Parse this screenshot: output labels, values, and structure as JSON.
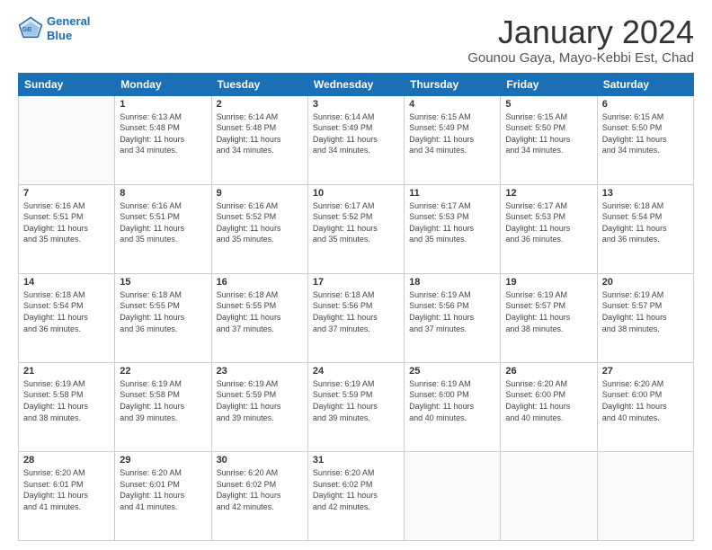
{
  "header": {
    "logo": {
      "line1": "General",
      "line2": "Blue"
    },
    "title": "January 2024",
    "subtitle": "Gounou Gaya, Mayo-Kebbi Est, Chad"
  },
  "days_of_week": [
    "Sunday",
    "Monday",
    "Tuesday",
    "Wednesday",
    "Thursday",
    "Friday",
    "Saturday"
  ],
  "weeks": [
    [
      {
        "num": "",
        "info": ""
      },
      {
        "num": "1",
        "info": "Sunrise: 6:13 AM\nSunset: 5:48 PM\nDaylight: 11 hours\nand 34 minutes."
      },
      {
        "num": "2",
        "info": "Sunrise: 6:14 AM\nSunset: 5:48 PM\nDaylight: 11 hours\nand 34 minutes."
      },
      {
        "num": "3",
        "info": "Sunrise: 6:14 AM\nSunset: 5:49 PM\nDaylight: 11 hours\nand 34 minutes."
      },
      {
        "num": "4",
        "info": "Sunrise: 6:15 AM\nSunset: 5:49 PM\nDaylight: 11 hours\nand 34 minutes."
      },
      {
        "num": "5",
        "info": "Sunrise: 6:15 AM\nSunset: 5:50 PM\nDaylight: 11 hours\nand 34 minutes."
      },
      {
        "num": "6",
        "info": "Sunrise: 6:15 AM\nSunset: 5:50 PM\nDaylight: 11 hours\nand 34 minutes."
      }
    ],
    [
      {
        "num": "7",
        "info": "Sunrise: 6:16 AM\nSunset: 5:51 PM\nDaylight: 11 hours\nand 35 minutes."
      },
      {
        "num": "8",
        "info": "Sunrise: 6:16 AM\nSunset: 5:51 PM\nDaylight: 11 hours\nand 35 minutes."
      },
      {
        "num": "9",
        "info": "Sunrise: 6:16 AM\nSunset: 5:52 PM\nDaylight: 11 hours\nand 35 minutes."
      },
      {
        "num": "10",
        "info": "Sunrise: 6:17 AM\nSunset: 5:52 PM\nDaylight: 11 hours\nand 35 minutes."
      },
      {
        "num": "11",
        "info": "Sunrise: 6:17 AM\nSunset: 5:53 PM\nDaylight: 11 hours\nand 35 minutes."
      },
      {
        "num": "12",
        "info": "Sunrise: 6:17 AM\nSunset: 5:53 PM\nDaylight: 11 hours\nand 36 minutes."
      },
      {
        "num": "13",
        "info": "Sunrise: 6:18 AM\nSunset: 5:54 PM\nDaylight: 11 hours\nand 36 minutes."
      }
    ],
    [
      {
        "num": "14",
        "info": "Sunrise: 6:18 AM\nSunset: 5:54 PM\nDaylight: 11 hours\nand 36 minutes."
      },
      {
        "num": "15",
        "info": "Sunrise: 6:18 AM\nSunset: 5:55 PM\nDaylight: 11 hours\nand 36 minutes."
      },
      {
        "num": "16",
        "info": "Sunrise: 6:18 AM\nSunset: 5:55 PM\nDaylight: 11 hours\nand 37 minutes."
      },
      {
        "num": "17",
        "info": "Sunrise: 6:18 AM\nSunset: 5:56 PM\nDaylight: 11 hours\nand 37 minutes."
      },
      {
        "num": "18",
        "info": "Sunrise: 6:19 AM\nSunset: 5:56 PM\nDaylight: 11 hours\nand 37 minutes."
      },
      {
        "num": "19",
        "info": "Sunrise: 6:19 AM\nSunset: 5:57 PM\nDaylight: 11 hours\nand 38 minutes."
      },
      {
        "num": "20",
        "info": "Sunrise: 6:19 AM\nSunset: 5:57 PM\nDaylight: 11 hours\nand 38 minutes."
      }
    ],
    [
      {
        "num": "21",
        "info": "Sunrise: 6:19 AM\nSunset: 5:58 PM\nDaylight: 11 hours\nand 38 minutes."
      },
      {
        "num": "22",
        "info": "Sunrise: 6:19 AM\nSunset: 5:58 PM\nDaylight: 11 hours\nand 39 minutes."
      },
      {
        "num": "23",
        "info": "Sunrise: 6:19 AM\nSunset: 5:59 PM\nDaylight: 11 hours\nand 39 minutes."
      },
      {
        "num": "24",
        "info": "Sunrise: 6:19 AM\nSunset: 5:59 PM\nDaylight: 11 hours\nand 39 minutes."
      },
      {
        "num": "25",
        "info": "Sunrise: 6:19 AM\nSunset: 6:00 PM\nDaylight: 11 hours\nand 40 minutes."
      },
      {
        "num": "26",
        "info": "Sunrise: 6:20 AM\nSunset: 6:00 PM\nDaylight: 11 hours\nand 40 minutes."
      },
      {
        "num": "27",
        "info": "Sunrise: 6:20 AM\nSunset: 6:00 PM\nDaylight: 11 hours\nand 40 minutes."
      }
    ],
    [
      {
        "num": "28",
        "info": "Sunrise: 6:20 AM\nSunset: 6:01 PM\nDaylight: 11 hours\nand 41 minutes."
      },
      {
        "num": "29",
        "info": "Sunrise: 6:20 AM\nSunset: 6:01 PM\nDaylight: 11 hours\nand 41 minutes."
      },
      {
        "num": "30",
        "info": "Sunrise: 6:20 AM\nSunset: 6:02 PM\nDaylight: 11 hours\nand 42 minutes."
      },
      {
        "num": "31",
        "info": "Sunrise: 6:20 AM\nSunset: 6:02 PM\nDaylight: 11 hours\nand 42 minutes."
      },
      {
        "num": "",
        "info": ""
      },
      {
        "num": "",
        "info": ""
      },
      {
        "num": "",
        "info": ""
      }
    ]
  ]
}
